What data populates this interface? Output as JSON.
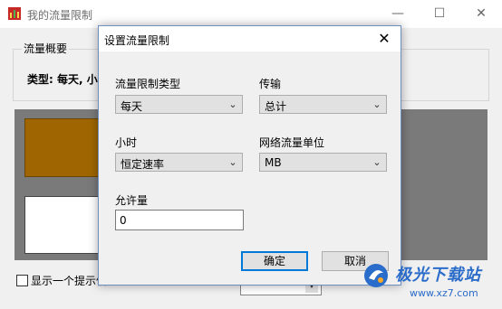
{
  "main_window": {
    "title": "我的流量限制",
    "controls": {
      "minimize": "—",
      "maximize": "☐",
      "close": "✕"
    },
    "group_label": "流量概要",
    "summary": "类型: 每天, 小时",
    "show_tip_label": "显示一个提示信",
    "show_tip_checked": false
  },
  "dialog": {
    "title": "设置流量限制",
    "close": "✕",
    "limit_type": {
      "label": "流量限制类型",
      "value": "每天"
    },
    "transfer": {
      "label": "传输",
      "value": "总计"
    },
    "hour": {
      "label": "小时",
      "value": "恒定速率"
    },
    "unit": {
      "label": "网络流量单位",
      "value": "MB"
    },
    "allowance": {
      "label": "允许量",
      "value": "0"
    },
    "ok_label": "确定",
    "cancel_label": "取消"
  },
  "watermark": {
    "brand": "极光下载站",
    "url": "www.xz7.com"
  },
  "colors": {
    "accent": "#0078d7",
    "orange": "#9f6500",
    "panel_gray": "#7a7a7a"
  }
}
